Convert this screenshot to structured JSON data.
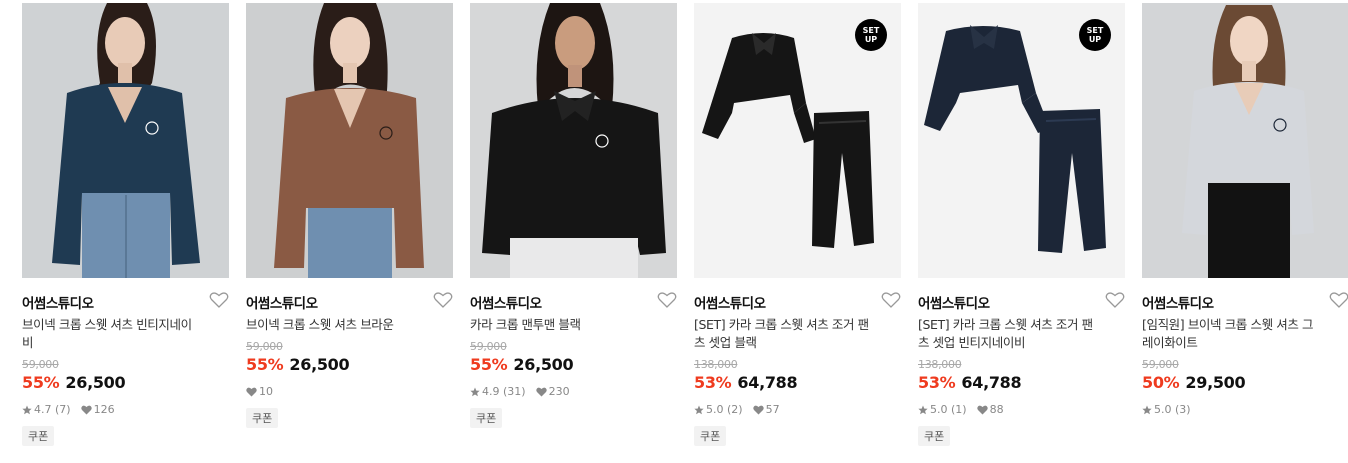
{
  "products": [
    {
      "brand": "어썸스튜디오",
      "name": "브이넥 크롭 스웻 셔츠 빈티지네이비",
      "original_price": "59,000",
      "discount": "55%",
      "price": "26,500",
      "rating": "4.7",
      "reviews": "(7)",
      "likes": "126",
      "coupon": "쿠폰",
      "badge": "",
      "image": "model-navy-sweatshirt"
    },
    {
      "brand": "어썸스튜디오",
      "name": "브이넥 크롭 스웻 셔츠 브라운",
      "original_price": "59,000",
      "discount": "55%",
      "price": "26,500",
      "rating": "",
      "reviews": "",
      "likes": "10",
      "coupon": "쿠폰",
      "badge": "",
      "image": "model-brown-sweatshirt"
    },
    {
      "brand": "어썸스튜디오",
      "name": "카라 크롭 맨투맨 블랙",
      "original_price": "59,000",
      "discount": "55%",
      "price": "26,500",
      "rating": "4.9",
      "reviews": "(31)",
      "likes": "230",
      "coupon": "쿠폰",
      "badge": "",
      "image": "model-black-collar-sweatshirt"
    },
    {
      "brand": "어썸스튜디오",
      "name": "[SET] 카라 크롭 스웻 셔츠 조거 팬츠 셋업 블랙",
      "original_price": "138,000",
      "discount": "53%",
      "price": "64,788",
      "rating": "5.0",
      "reviews": "(2)",
      "likes": "57",
      "coupon": "쿠폰",
      "badge": "SET UP",
      "image": "flatlay-black-setup"
    },
    {
      "brand": "어썸스튜디오",
      "name": "[SET] 카라 크롭 스웻 셔츠 조거 팬츠 셋업 빈티지네이비",
      "original_price": "138,000",
      "discount": "53%",
      "price": "64,788",
      "rating": "5.0",
      "reviews": "(1)",
      "likes": "88",
      "coupon": "쿠폰",
      "badge": "SET UP",
      "image": "flatlay-navy-setup"
    },
    {
      "brand": "어썸스튜디오",
      "name": "[임직원] 브이넥 크롭 스웻 셔츠 그레이화이트",
      "original_price": "59,000",
      "discount": "50%",
      "price": "29,500",
      "rating": "5.0",
      "reviews": "(3)",
      "likes": "",
      "coupon": "",
      "badge": "",
      "image": "model-grey-sweatshirt"
    }
  ],
  "colors": {
    "discount": "#ef3b1f",
    "navy": "#1f3a52",
    "brown": "#8a5a44",
    "black": "#151515",
    "grey": "#d4d7dc"
  }
}
